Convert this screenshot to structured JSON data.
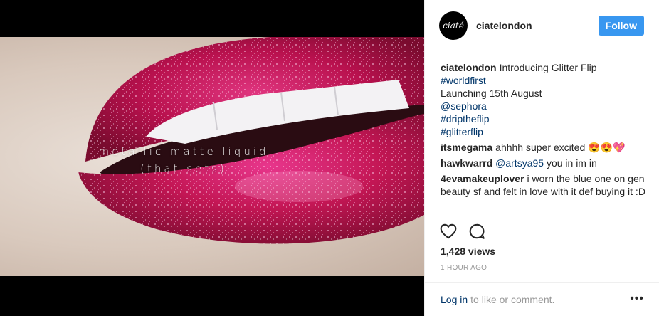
{
  "media": {
    "overlay_line1": "metallic matte liquid",
    "overlay_line2": "(that sets)"
  },
  "header": {
    "avatar_text": "ciaté",
    "username": "ciatelondon",
    "follow_label": "Follow"
  },
  "post": {
    "author": "ciatelondon",
    "caption": "Introducing Glitter Flip",
    "hashtag1": "#worldfirst",
    "line2": "Launching 15th August",
    "mention": "@sephora",
    "hashtag2": "#driptheflip",
    "hashtag3": "#glitterflip"
  },
  "comments": [
    {
      "user": "itsmegama",
      "text": "ahhhh super excited 😍😍💖"
    },
    {
      "user": "hawkwarrd",
      "mention": "@artsya95",
      "text": "you in im in"
    },
    {
      "user": "4evamakeuplover",
      "text": "i worn the blue one on gen beauty sf and felt in love with it def buying it :D"
    }
  ],
  "stats": {
    "views": "1,428 views",
    "time": "1 HOUR AGO"
  },
  "footer": {
    "login_label": "Log in",
    "rest": "to like or comment.",
    "more": "•••"
  },
  "colors": {
    "follow_bg": "#3897f0",
    "link": "#003569",
    "muted": "#999999"
  },
  "icons": [
    "heart-icon",
    "comment-icon",
    "more-options-icon"
  ]
}
